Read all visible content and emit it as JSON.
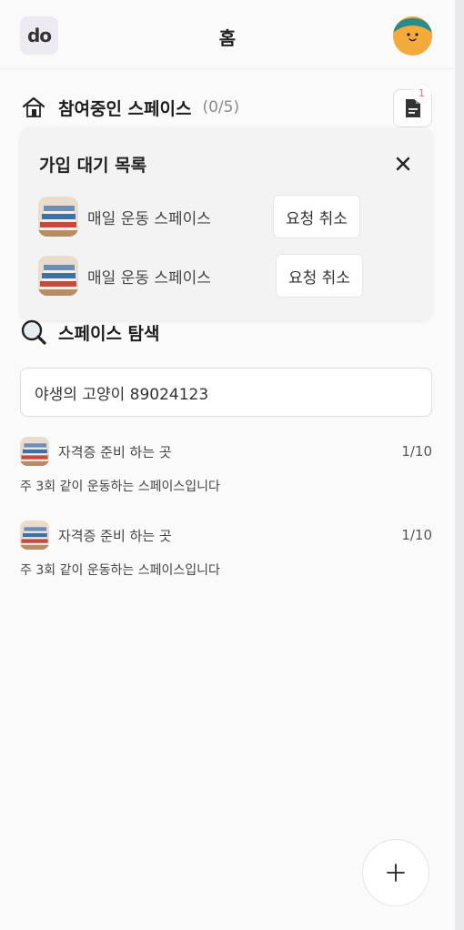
{
  "header": {
    "logo_text": "do",
    "title": "홈"
  },
  "joined": {
    "title": "참여중인 스페이스",
    "count": "(0/5)",
    "badge_count": "1"
  },
  "pending": {
    "title": "가입 대기 목록",
    "items": [
      {
        "name": "매일 운동 스페이스",
        "cancel_label": "요청 취소"
      },
      {
        "name": "매일 운동 스페이스",
        "cancel_label": "요청 취소"
      }
    ]
  },
  "explore": {
    "title": "스페이스 탐색",
    "search_value": "야생의 고양이 89024123",
    "spaces": [
      {
        "name": "자격증 준비 하는 곳",
        "count": "1/10",
        "desc": "주 3회 같이 운동하는 스페이스입니다"
      },
      {
        "name": "자격증 준비 하는 곳",
        "count": "1/10",
        "desc": "주 3회 같이 운동하는 스페이스입니다"
      }
    ]
  },
  "icons": {
    "home": "home-icon",
    "document": "document-icon",
    "close": "close-icon",
    "search": "magnifier-icon",
    "add": "plus-icon"
  },
  "colors": {
    "badge": "#f06a6a",
    "avatar_bg": "#f4a93b",
    "avatar_hair": "#2a8b8a"
  }
}
